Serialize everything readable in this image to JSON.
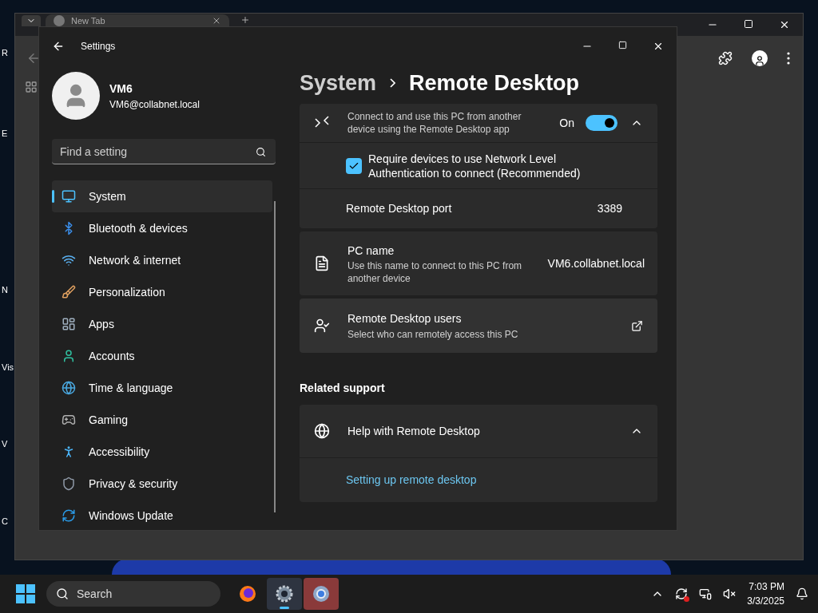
{
  "desktop_icons": [
    "R",
    "E",
    "N",
    "Vis",
    "V",
    "C"
  ],
  "browser": {
    "tab_title": "New Tab"
  },
  "settings": {
    "title": "Settings",
    "user": {
      "name": "VM6",
      "email": "VM6@collabnet.local"
    },
    "search": {
      "placeholder": "Find a setting"
    },
    "nav": [
      {
        "kind": "system",
        "label": "System",
        "selected": true
      },
      {
        "kind": "bluetooth",
        "label": "Bluetooth & devices",
        "selected": false
      },
      {
        "kind": "network",
        "label": "Network & internet",
        "selected": false
      },
      {
        "kind": "brush",
        "label": "Personalization",
        "selected": false
      },
      {
        "kind": "apps",
        "label": "Apps",
        "selected": false
      },
      {
        "kind": "accounts",
        "label": "Accounts",
        "selected": false
      },
      {
        "kind": "time",
        "label": "Time & language",
        "selected": false
      },
      {
        "kind": "gaming",
        "label": "Gaming",
        "selected": false
      },
      {
        "kind": "accessibility",
        "label": "Accessibility",
        "selected": false
      },
      {
        "kind": "privacy",
        "label": "Privacy & security",
        "selected": false
      },
      {
        "kind": "update",
        "label": "Windows Update",
        "selected": false
      }
    ],
    "breadcrumb": {
      "parent": "System",
      "current": "Remote Desktop"
    },
    "remote_desktop": {
      "description": "Connect to and use this PC from another device using the Remote Desktop app",
      "state_label": "On",
      "on": true,
      "expanded": true
    },
    "nla": {
      "label": "Require devices to use Network Level Authentication to connect (Recommended)",
      "checked": true
    },
    "port": {
      "label": "Remote Desktop port",
      "value": "3389"
    },
    "pc_name": {
      "title": "PC name",
      "description": "Use this name to connect to this PC from another device",
      "value": "VM6.collabnet.local"
    },
    "users": {
      "title": "Remote Desktop users",
      "description": "Select who can remotely access this PC"
    },
    "related_heading": "Related support",
    "help": {
      "title": "Help with Remote Desktop",
      "expanded": true,
      "links": [
        "Setting up remote desktop"
      ]
    }
  },
  "taskbar": {
    "search_placeholder": "Search",
    "time": "7:03 PM",
    "date": "3/3/2025",
    "apps": [
      {
        "kind": "firefox",
        "running": false,
        "attention": false
      },
      {
        "kind": "settings",
        "running": true,
        "attention": false
      },
      {
        "kind": "browser",
        "running": false,
        "attention": true
      }
    ]
  }
}
